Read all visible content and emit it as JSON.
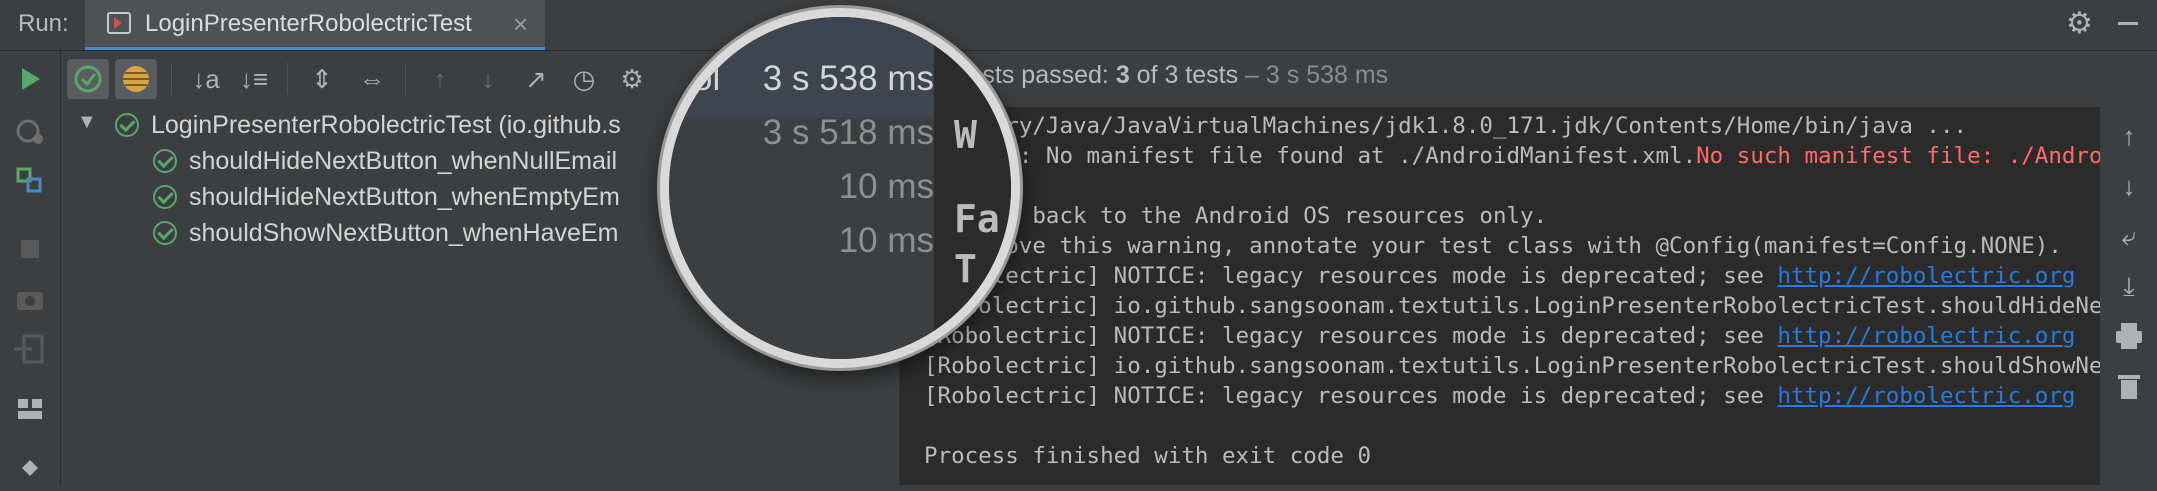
{
  "topbar": {
    "run_label": "Run:",
    "tab_title": "LoginPresenterRobolectricTest",
    "close_glyph": "×",
    "gear_glyph": "⚙"
  },
  "left_toolbar": {
    "icons": [
      "play-icon",
      "rerun-failed-icon",
      "toggle-auto-test-icon",
      "stop-icon",
      "camera-icon",
      "exit-icon",
      "layout-icon",
      "pin-icon"
    ]
  },
  "test_toolbar": {
    "glyphs": {
      "sort_alpha": "↓a",
      "sort_duration": "↓≡",
      "expand": "⇕",
      "collapse": "⇔",
      "up": "↑",
      "down": "↓",
      "export": "↗",
      "history": "◷",
      "settings": "⚙"
    }
  },
  "status": {
    "prefix": "Tests passed: ",
    "count": "3",
    "suffix": " of 3 tests",
    "dim": " – 3 s 538 ms"
  },
  "tree": {
    "root": {
      "label": "LoginPresenterRobolectricTest (io.github.s",
      "duration": "3 s 538 ms"
    },
    "items": [
      {
        "label": "shouldHideNextButton_whenNullEmail",
        "duration": "3 s 518 ms"
      },
      {
        "label": "shouldHideNextButton_whenEmptyEm",
        "duration": "10 ms"
      },
      {
        "label": "shouldShowNextButton_whenHaveEm",
        "duration": "10 ms"
      }
    ]
  },
  "console": {
    "line1": "/Library/Java/JavaVirtualMachines/jdk1.8.0_171.jdk/Contents/Home/bin/java ...",
    "line2_a": "WARNING: No manifest file found at ./AndroidManifest.xml.",
    "line2_b": "No such manifest file: ./AndroidManifest.xml",
    "line3": "",
    "line4": "Falling back to the Android OS resources only.",
    "line5": "To remove this warning, annotate your test class with @Config(manifest=Config.NONE).",
    "line6_a": "[Robolectric] NOTICE: legacy resources mode is deprecated; see ",
    "line6_link": "http://robolectric.org",
    "line7": "[Robolectric] io.github.sangsoonam.textutils.LoginPresenterRobolectricTest.shouldHideNextButton",
    "line8_a": "[Robolectric] NOTICE: legacy resources mode is deprecated; see ",
    "line8_link": "http://robolectric.org",
    "line9": "[Robolectric] io.github.sangsoonam.textutils.LoginPresenterRobolectricTest.shouldShowNextButton",
    "line10_a": "[Robolectric] NOTICE: legacy resources mode is deprecated; see ",
    "line10_link": "http://robolectric.org",
    "line11": "",
    "line12": "Process finished with exit code 0"
  },
  "magnifier": {
    "duration_root": "3 s 538 ms",
    "duration_1": "3 s 518 ms",
    "duration_2": "10 ms",
    "duration_3": "10 ms",
    "big_1": "W",
    "big_2": "Fa",
    "big_3": "T",
    "fragment": "ol"
  },
  "colors": {
    "pass_green": "#59a869",
    "error_red": "#ff6b68",
    "link_blue": "#287bde",
    "accent": "#4a88c7"
  }
}
